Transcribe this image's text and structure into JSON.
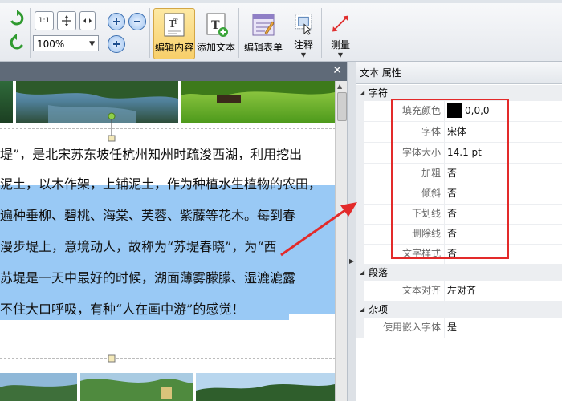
{
  "toolbar": {
    "zoom_value": "100%",
    "fit_label": "1:1",
    "edit_content_label": "编辑内容",
    "add_text_label": "添加文本",
    "edit_form_label": "编辑表单",
    "annotate_label": "注释",
    "measure_label": "测量"
  },
  "document": {
    "lines": [
      "堤”，是北宋苏东坡任杭州知州时疏浚西湖，利用挖出",
      "泥土，以木作架，上铺泥土，作为种植水生植物的农田，",
      "遍种垂柳、碧桃、海棠、芙蓉、紫藤等花木。每到春",
      "漫步堤上，意境动人，故称为“苏堤春晓”，为“西",
      "苏堤是一天中最好的时候，湖面薄雾朦朦、湿漉漉露",
      "不住大口呼吸，有种“人在画中游”的感觉！"
    ]
  },
  "panel": {
    "title": "文本 属性",
    "categories": {
      "char": "字符",
      "para": "段落",
      "misc": "杂项"
    },
    "char_props": [
      {
        "name": "填充颜色",
        "value": "0,0,0"
      },
      {
        "name": "字体",
        "value": "宋体"
      },
      {
        "name": "字体大小",
        "value": "14.1 pt"
      },
      {
        "name": "加粗",
        "value": "否"
      },
      {
        "name": "倾斜",
        "value": "否"
      },
      {
        "name": "下划线",
        "value": "否"
      },
      {
        "name": "删除线",
        "value": "否"
      },
      {
        "name": "文字样式",
        "value": "否"
      }
    ],
    "para_props": [
      {
        "name": "文本对齐",
        "value": "左对齐"
      }
    ],
    "misc_props": [
      {
        "name": "使用嵌入字体",
        "value": "是"
      }
    ]
  },
  "colors": {
    "fill_color": "#000000",
    "selection": "#99c9f5",
    "highlight_box": "#e32a2a"
  }
}
